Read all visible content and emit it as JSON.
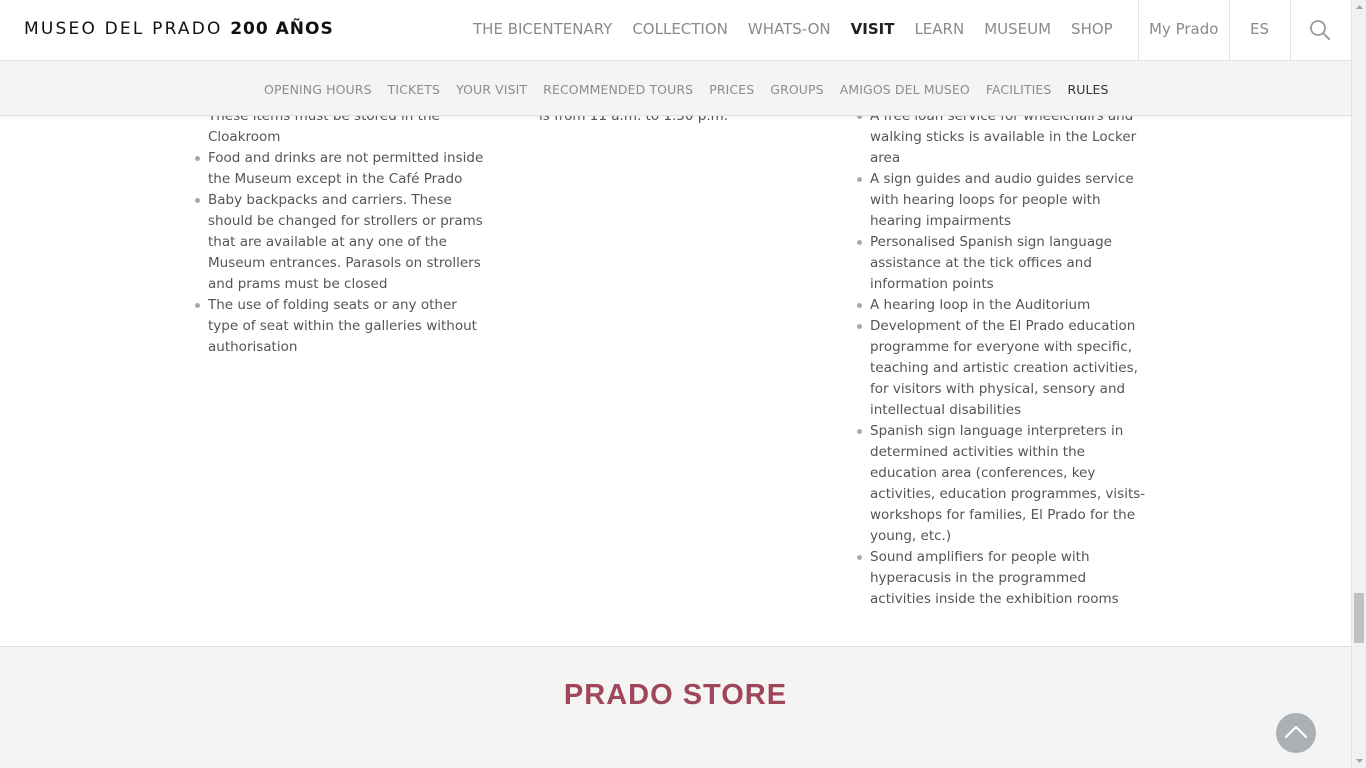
{
  "header": {
    "logo_text": "MUSEO DEL PRADO",
    "logo_strong": "200 AÑOS",
    "nav": [
      {
        "label": "THE BICENTENARY",
        "active": false
      },
      {
        "label": "COLLECTION",
        "active": false
      },
      {
        "label": "WHATS-ON",
        "active": false
      },
      {
        "label": "VISIT",
        "active": true
      },
      {
        "label": "LEARN",
        "active": false
      },
      {
        "label": "MUSEUM",
        "active": false
      },
      {
        "label": "SHOP",
        "active": false
      }
    ],
    "my_prado": "My Prado",
    "language": "ES",
    "search_icon": "search-icon"
  },
  "subnav": [
    {
      "label": "OPENING HOURS",
      "active": false
    },
    {
      "label": "TICKETS",
      "active": false
    },
    {
      "label": "YOUR VISIT",
      "active": false
    },
    {
      "label": "RECOMMENDED TOURS",
      "active": false
    },
    {
      "label": "PRICES",
      "active": false
    },
    {
      "label": "GROUPS",
      "active": false
    },
    {
      "label": "AMIGOS DEL MUSEO",
      "active": false
    },
    {
      "label": "FACILITIES",
      "active": false
    },
    {
      "label": "RULES",
      "active": true
    }
  ],
  "content": {
    "col1_items": [
      {
        "text": "These items must be stored in the Cloakroom",
        "continued": true
      },
      {
        "text": "Food and drinks are not permitted inside the Museum except in the Café Prado",
        "continued": false
      },
      {
        "text": "Baby backpacks and carriers. These should be changed for strollers or prams that are available at any one of the Museum entrances. Parasols on strollers and prams must be closed",
        "continued": false
      },
      {
        "text": "The use of folding seats or any other type of seat within the galleries without authorisation",
        "continued": false
      }
    ],
    "col2_text": "is from 11 a.m. to 1.30 p.m.",
    "col3_items": [
      {
        "text": "A free loan service for wheelchairs and walking sticks is available in the Locker area",
        "continued": false
      },
      {
        "text": "A sign guides and audio guides service with hearing loops for people with hearing impairments",
        "continued": false
      },
      {
        "text": "Personalised Spanish sign language assistance at the tick offices and information points",
        "continued": false
      },
      {
        "text": "A hearing loop in the Auditorium",
        "continued": false
      },
      {
        "text": "Development of the El Prado education programme for everyone with specific, teaching and artistic creation activities, for visitors with physical, sensory and intellectual disabilities",
        "continued": false
      },
      {
        "text": "Spanish sign language interpreters in determined activities within the education area (conferences, key activities, education programmes, visits-workshops for families, El Prado for the young, etc.)",
        "continued": false
      },
      {
        "text": "Sound amplifiers for people with hyperacusis in the programmed activities inside the exhibition rooms",
        "continued": false
      }
    ]
  },
  "store": {
    "title": "PRADO STORE"
  },
  "back_to_top_icon": "chevron-up-icon",
  "colors": {
    "accent": "#a0465b",
    "nav_active": "#222222",
    "nav_inactive": "#8a8a8a",
    "band_background": "#f4f4f4"
  }
}
